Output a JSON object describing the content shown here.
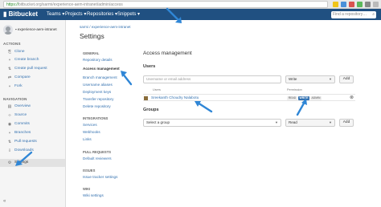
{
  "browser": {
    "url_secure_label": "https://",
    "url_rest": "bitbucket.org/sarmi/experience-aem-intranet/admin/access"
  },
  "topnav": {
    "logo": "Bitbucket",
    "items": [
      "Teams ▾",
      "Projects ▾",
      "Repositories ▾",
      "Snippets ▾"
    ],
    "create_label": "Create",
    "search_placeholder": "Find a repository…",
    "brand_color": "#205081"
  },
  "sidebar": {
    "repo_name": "experience-aem-intranet",
    "actions_heading": "ACTIONS",
    "actions": [
      {
        "label": "Clone",
        "icon": "clone-icon"
      },
      {
        "label": "Create branch",
        "icon": "branch-icon"
      },
      {
        "label": "Create pull request",
        "icon": "pull-request-icon"
      },
      {
        "label": "Compare",
        "icon": "compare-icon"
      },
      {
        "label": "Fork",
        "icon": "fork-icon"
      }
    ],
    "navigation_heading": "NAVIGATION",
    "navigation": [
      {
        "label": "Overview",
        "icon": "overview-icon"
      },
      {
        "label": "Source",
        "icon": "source-icon"
      },
      {
        "label": "Commits",
        "icon": "commits-icon"
      },
      {
        "label": "Branches",
        "icon": "branches-icon"
      },
      {
        "label": "Pull requests",
        "icon": "pull-requests-icon"
      },
      {
        "label": "Downloads",
        "icon": "downloads-icon"
      },
      {
        "label": "Settings",
        "icon": "settings-icon"
      }
    ]
  },
  "main": {
    "breadcrumb": "sarmi / experience-aem-intranet",
    "title": "Settings",
    "settings_nav": {
      "general_heading": "GENERAL",
      "general_items": [
        "Repository details",
        "Access management",
        "Branch management",
        "Username aliases",
        "Deployment keys",
        "Transfer repository",
        "Delete repository"
      ],
      "integrations_heading": "INTEGRATIONS",
      "integrations_items": [
        "Services",
        "Webhooks",
        "Links"
      ],
      "pull_requests_heading": "PULL REQUESTS",
      "pull_requests_items": [
        "Default reviewers"
      ],
      "issues_heading": "ISSUES",
      "issues_items": [
        "Issue tracker settings"
      ],
      "wiki_heading": "WIKI",
      "wiki_items": [
        "Wiki settings"
      ]
    },
    "access": {
      "title": "Access management",
      "users_heading": "Users",
      "user_input_placeholder": "Username or email address",
      "user_permission": "Write",
      "add_label": "Add",
      "col_users": "Users",
      "col_permission": "Permission",
      "user_row_name": "Sreekanth Choudry Nalabotu",
      "perm_read": "READ",
      "perm_write": "WRITE",
      "perm_admin": "ADMIN",
      "groups_heading": "Groups",
      "group_select_placeholder": "Select a group",
      "group_permission": "Read",
      "group_add_label": "Add"
    }
  }
}
